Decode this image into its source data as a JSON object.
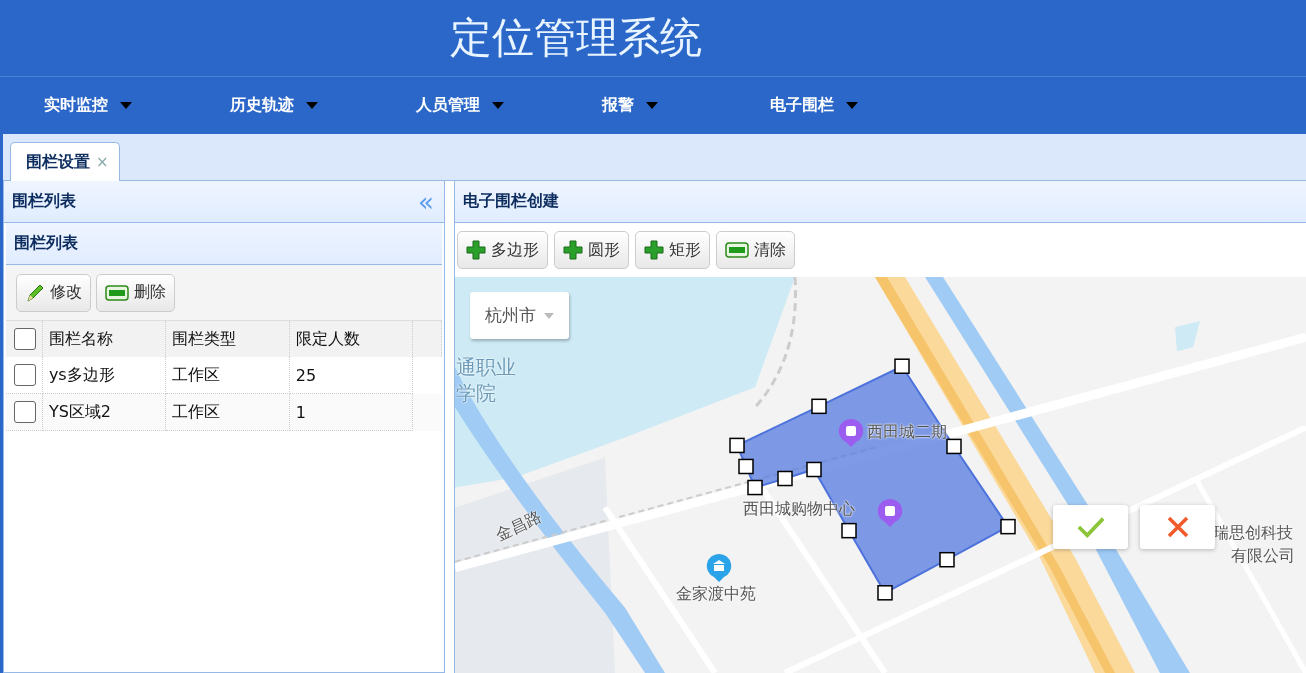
{
  "header": {
    "title": "定位管理系统"
  },
  "nav": [
    {
      "label": "实时监控"
    },
    {
      "label": "历史轨迹"
    },
    {
      "label": "人员管理"
    },
    {
      "label": "报警"
    },
    {
      "label": "电子围栏"
    }
  ],
  "tabs": [
    {
      "label": "围栏设置",
      "selected": true,
      "close": "×"
    }
  ],
  "left_panel": {
    "title": "围栏列表",
    "collapse": "«",
    "subtitle": "围栏列表",
    "toolbar": [
      {
        "kind": "edit",
        "label": "修改"
      },
      {
        "kind": "remove",
        "label": "删除"
      }
    ],
    "table": {
      "all_checked": false,
      "columns": [
        "围栏名称",
        "围栏类型",
        "限定人数"
      ],
      "rows": [
        {
          "checked": false,
          "cells": [
            "ys多边形",
            "工作区",
            "25"
          ]
        },
        {
          "checked": false,
          "cells": [
            "YS区域2",
            "工作区",
            "1"
          ]
        }
      ]
    }
  },
  "right_panel": {
    "title": "电子围栏创建",
    "toolbar": [
      {
        "kind": "add",
        "label": "多边形"
      },
      {
        "kind": "add",
        "label": "圆形"
      },
      {
        "kind": "add",
        "label": "矩形"
      },
      {
        "kind": "remove",
        "label": "清除"
      }
    ],
    "map": {
      "city": "杭州市",
      "labels": [
        {
          "kind": "water",
          "text": "通职业"
        },
        {
          "kind": "water",
          "text": "学院"
        },
        {
          "kind": "poi",
          "text": "西田城二期"
        },
        {
          "kind": "poi",
          "text": "西田城购物中心"
        },
        {
          "kind": "road",
          "text": "金昌路"
        },
        {
          "kind": "poi",
          "text": "金家渡中苑"
        },
        {
          "kind": "poi",
          "text": "瑞思创科技"
        },
        {
          "kind": "poi",
          "text": "有限公司"
        }
      ],
      "pins": [
        {
          "kind": "shop"
        },
        {
          "kind": "shop"
        },
        {
          "kind": "home"
        }
      ]
    }
  }
}
